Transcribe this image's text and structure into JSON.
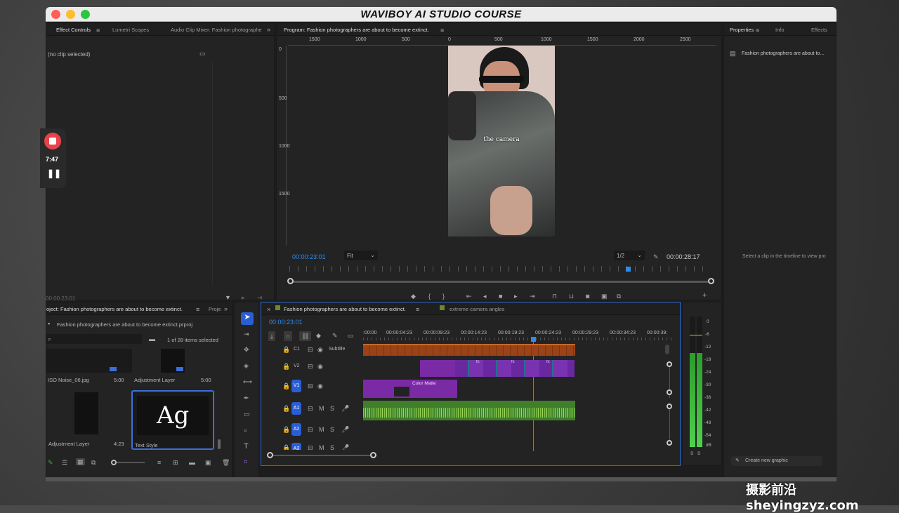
{
  "window": {
    "title": "WAVIBOY AI STUDIO COURSE"
  },
  "effect_panel": {
    "tabs": [
      "Effect Controls",
      "Lumetri Scopes",
      "Audio Clip Mixer: Fashion photographe"
    ],
    "no_clip": "(no clip selected)",
    "timecode": "00:00:23:01"
  },
  "recording": {
    "time": "7:47"
  },
  "program": {
    "tab": "Program: Fashion photographers are about to become extinct.",
    "ruler": [
      "1500",
      "1000",
      "500",
      "0",
      "500",
      "1000",
      "1500",
      "2000",
      "2500"
    ],
    "vruler": [
      "0",
      "500",
      "1000",
      "1500"
    ],
    "caption": "the camera",
    "timecode": "00:00:23:01",
    "fit": "Fit",
    "resolution": "1/2",
    "duration": "00:00:28:17"
  },
  "properties": {
    "tabs": [
      "Properties",
      "Info",
      "Effects"
    ],
    "sequence": "Fashion photographers are about to...",
    "hint": "Select a clip in the timeline to view pro",
    "create_button": "Create new graphic"
  },
  "project": {
    "tab": "oject: Fashion photographers are about to become extinct.",
    "tab2": "Proje",
    "file": "Fashion photographers are about to become extinct.prproj",
    "selection": "1 of 28 items selected",
    "items": [
      {
        "name": "ISO Noise_06.jpg",
        "duration": "5:00"
      },
      {
        "name": "Adjustment Layer",
        "duration": "5:00"
      },
      {
        "name": "Adjustment Layer",
        "duration": "4:23"
      },
      {
        "name": "Text Style",
        "duration": ""
      }
    ],
    "thumb_text": "Ag"
  },
  "timeline": {
    "tabs": [
      "Fashion photographers are about to become extinct.",
      "extreme camera angles"
    ],
    "timecode": "00:00:23:01",
    "ruler": [
      ":00:00",
      "00:00:04:23",
      "00:00:09:23",
      "00:00:14:23",
      "00:00:19:23",
      "00:00:24:23",
      "00:00:29:23",
      "00:00:34:23",
      "00:00:39:"
    ],
    "tracks": [
      {
        "id": "C1",
        "label": "Subtitle"
      },
      {
        "id": "V2",
        "label": ""
      },
      {
        "id": "V1",
        "label": ""
      },
      {
        "id": "A1",
        "label": ""
      },
      {
        "id": "A2",
        "label": ""
      },
      {
        "id": "A3",
        "label": ""
      }
    ],
    "clip_label": "Color Matte",
    "fx": "fx"
  },
  "meters": {
    "scale": [
      "0",
      "-6",
      "-12",
      "-18",
      "-24",
      "-30",
      "-36",
      "-42",
      "-48",
      "-54",
      "dB"
    ],
    "solo": "S"
  },
  "watermark": "摄影前沿 sheyingzyz.com",
  "colors": {
    "accent": "#2d8ceb",
    "subtitle_clip": "#8a3a1a",
    "video_clip": "#7a2fa8",
    "audio_clip": "#3f7f2a"
  }
}
